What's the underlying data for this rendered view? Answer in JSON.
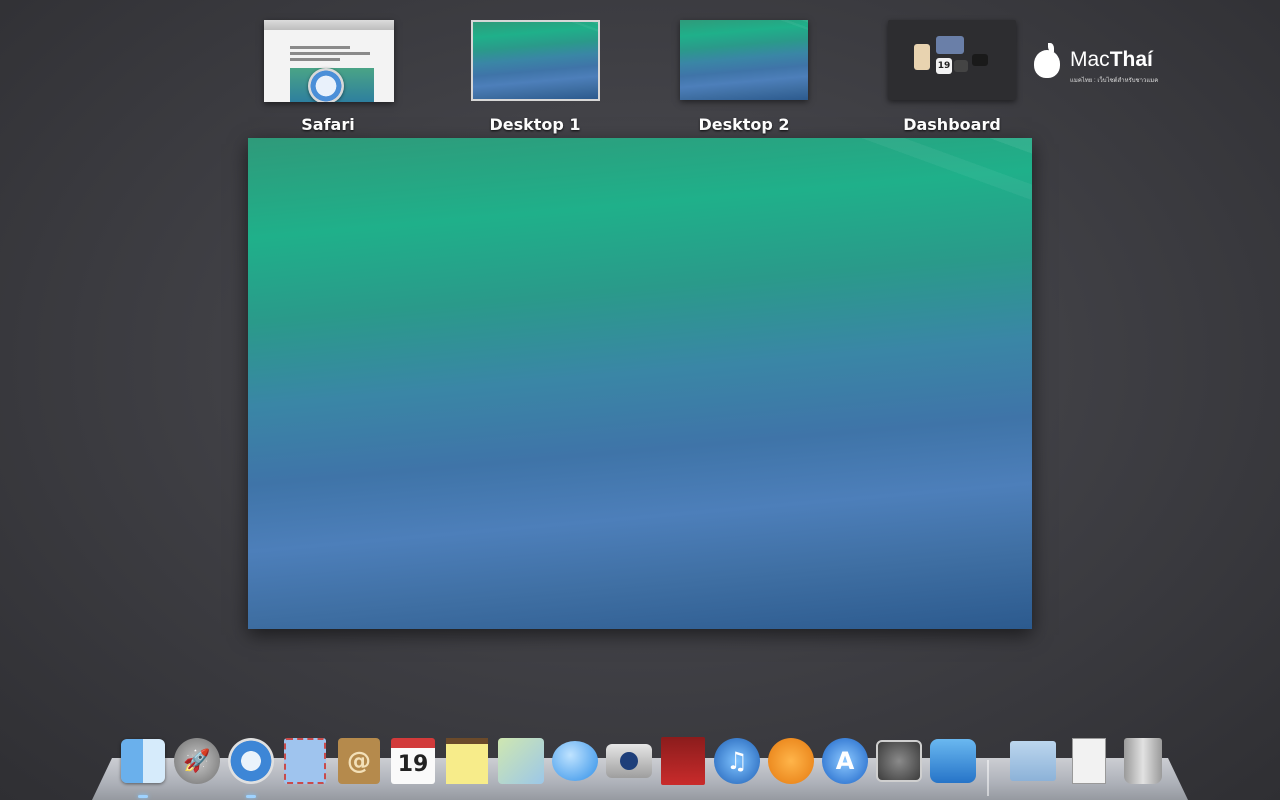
{
  "spaces": [
    {
      "label": "Safari"
    },
    {
      "label": "Desktop 1"
    },
    {
      "label": "Desktop 2"
    },
    {
      "label": "Dashboard"
    }
  ],
  "safari_preview": {
    "headline": "OS X Mavericks Golden Master now available for all Developer Preview users"
  },
  "dashboard_preview": {
    "calendar_day": "19"
  },
  "watermark": {
    "brand_light": "Mac",
    "brand_bold": "Thaí",
    "tagline": "แมคไทย : เว็บไซต์สำหรับชาวแมค"
  },
  "dock": {
    "calendar_day": "19",
    "apps": [
      "finder",
      "launchpad",
      "safari",
      "mail",
      "contacts",
      "calendar",
      "notes",
      "maps",
      "messages",
      "facetime",
      "photo-booth",
      "itunes",
      "ibooks",
      "app-store",
      "system-preferences",
      "twitter"
    ],
    "stacks": [
      "documents-folder",
      "downloads-stack",
      "trash"
    ]
  },
  "colors": {
    "desktop_bg": "#3d3d42",
    "label_text": "#ffffff",
    "active_border": "#d7d7d7"
  }
}
